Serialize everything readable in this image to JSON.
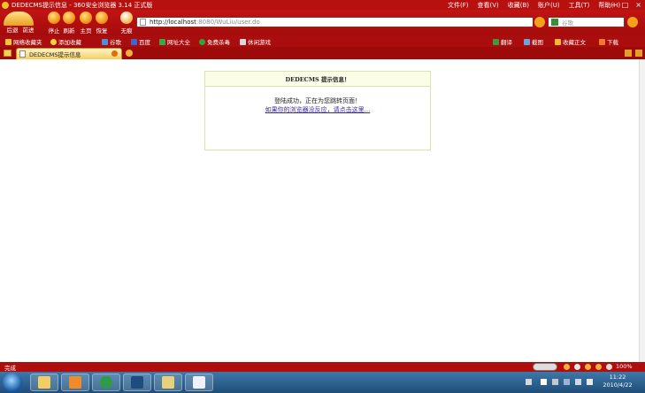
{
  "window": {
    "title": "DEDECMS提示信息 - 360安全浏览器 3.14 正式版",
    "menus": [
      "文件(F)",
      "查看(V)",
      "收藏(B)",
      "账户(U)",
      "工具(T)",
      "帮助(H)"
    ],
    "controls": [
      "–",
      "□",
      "×"
    ]
  },
  "toolbar": {
    "back": "后退",
    "forward": "前进",
    "stop": "停止",
    "refresh": "刷新",
    "home": "主页",
    "restore": "恢复",
    "notrace": "无痕"
  },
  "address": {
    "url_host": "http://localhost",
    "url_rest": ":8080/WuLiu/user.do"
  },
  "search": {
    "placeholder": "谷歌"
  },
  "favorites": {
    "left": [
      "网络收藏夹",
      "添加收藏"
    ],
    "items": [
      "谷歌",
      "百度",
      "网址大全",
      "免费杀毒",
      "休闲游戏"
    ],
    "right": [
      "翻译",
      "截图",
      "收藏正文",
      "下载"
    ]
  },
  "tabs": [
    {
      "label": "DEDECMS提示信息"
    }
  ],
  "message": {
    "header": "DEDECMS 提示信息！",
    "line1": "登陆成功，正在为您跳转页面！",
    "link": "如果你的浏览器没反应，请点击这里..."
  },
  "statusbar": {
    "status": "完成",
    "zoom": "100%"
  },
  "taskbar": {
    "time": "11:22",
    "date": "2010/4/22"
  },
  "colors": {
    "chrome_red": "#b80f0f",
    "tab_gold": "#f4cf63",
    "msg_border": "#d8e6a8",
    "link_color": "#3a2a9a",
    "taskbar_blue": "#2f6494"
  }
}
